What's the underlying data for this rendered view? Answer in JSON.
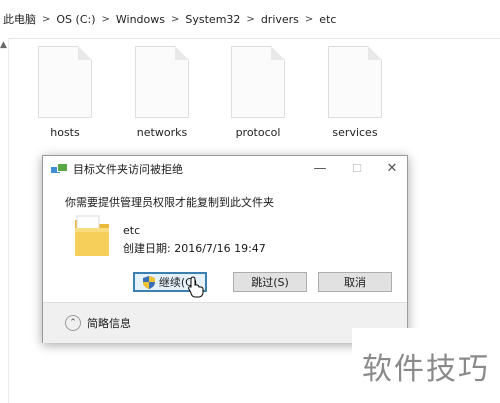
{
  "address_bar": {
    "crumbs": [
      "此电脑",
      "OS (C:)",
      "Windows",
      "System32",
      "drivers",
      "etc"
    ],
    "separator": ">"
  },
  "files": [
    {
      "name": "hosts",
      "icon": "file-icon"
    },
    {
      "name": "networks",
      "icon": "file-icon"
    },
    {
      "name": "protocol",
      "icon": "file-icon"
    },
    {
      "name": "services",
      "icon": "file-icon"
    }
  ],
  "dialog": {
    "title": "目标文件夹访问被拒绝",
    "minimize": "—",
    "maximize": "☐",
    "close": "✕",
    "message": "你需要提供管理员权限才能复制到此文件夹",
    "item_name": "etc",
    "item_date": "创建日期: 2016/7/16 19:47",
    "buttons": {
      "continue": "继续(C)",
      "skip": "跳过(S)",
      "cancel": "取消"
    },
    "details_label": "简略信息"
  },
  "watermark": "软件技巧",
  "colors": {
    "accent": "#3c7fb1",
    "button_bg": "#e1e1e1",
    "folder": "#f4c542"
  }
}
